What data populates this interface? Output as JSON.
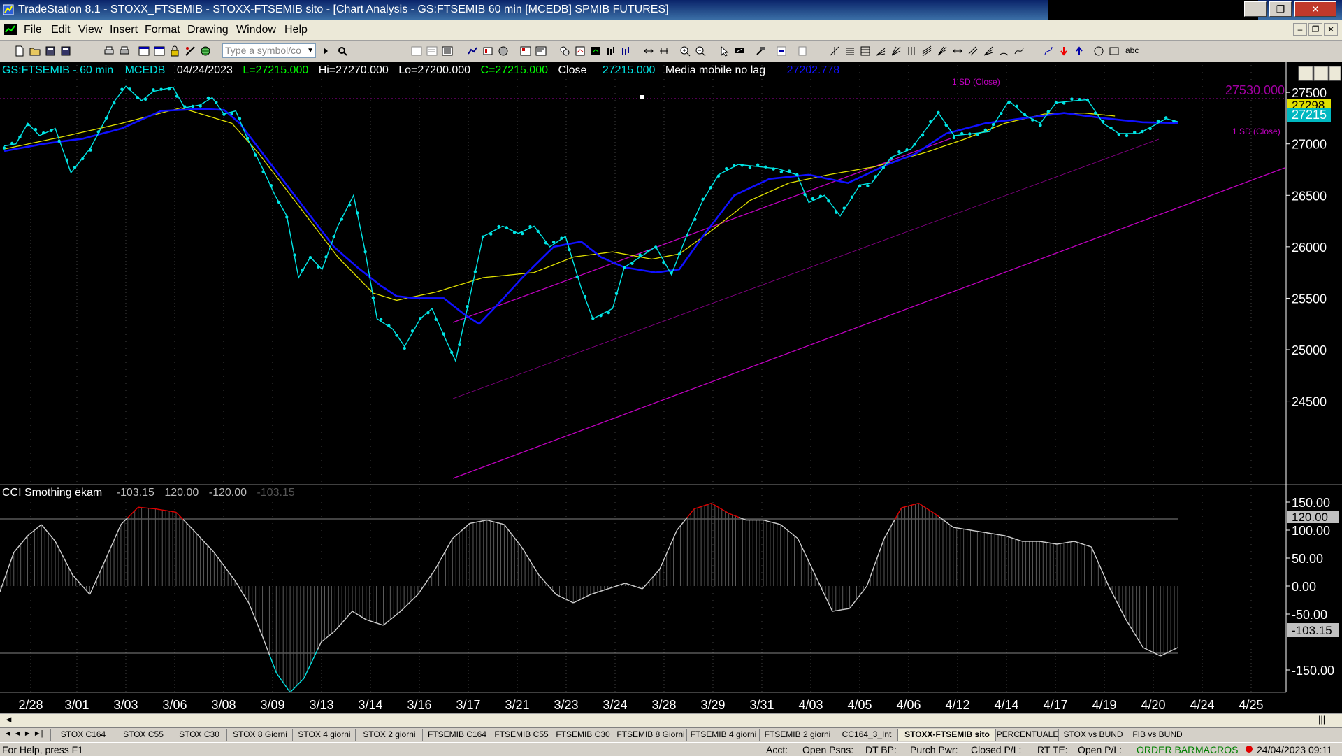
{
  "window": {
    "title": "TradeStation 8.1 - STOXX_FTSEMIB - STOXX-FTSEMIB sito - [Chart Analysis - GS:FTSEMIB  60 min  [MCEDB] SPMIB FUTURES]",
    "minimize": "–",
    "maximize": "❐",
    "close": "✕"
  },
  "menu": {
    "items": [
      "File",
      "Edit",
      "View",
      "Insert",
      "Format",
      "Drawing",
      "Window",
      "Help"
    ],
    "mdi_minimize": "–",
    "mdi_restore": "❐",
    "mdi_close": "✕"
  },
  "toolbar": {
    "symbol_placeholder": "Type a symbol/co",
    "abc_label": "abc"
  },
  "chart": {
    "header": {
      "symbol": "GS:FTSEMIB - 60 min",
      "data": "MCEDB",
      "date": "04/24/2023",
      "last": "L=27215.000",
      "high": "Hi=27270.000",
      "low": "Lo=27200.000",
      "close": "C=27215.000",
      "close_label": "Close",
      "close_value": "27215.000",
      "indicator": "Media mobile no lag",
      "indicator_value": "27202.778"
    },
    "channel_upper_label": "1 SD (Close)",
    "channel_right_label": "1 SD (Close)",
    "price_marker_magenta": "27530.000",
    "price_marker_yellow": "27298",
    "price_marker_cyan": "27215",
    "cci_header": {
      "name": "CCI Smothing ekam",
      "v1": "-103.15",
      "v2": "120.00",
      "v3": "-120.00",
      "v4": "-103.15"
    },
    "cci_marker_120": "120.00",
    "cci_marker_current": "-103.15",
    "cci_marker_behind": "-120.00",
    "colors": {
      "close_dots": "#00e5e5",
      "blue_ma": "#1010ff",
      "yellow_ma": "#e0e000",
      "channel": "#c000c0",
      "cci_line": "#d0d0d0",
      "cci_extreme": "#e00000"
    }
  },
  "chart_data": {
    "type": "line",
    "price_axis": {
      "ticks": [
        27500,
        27000,
        26500,
        26000,
        25500,
        25000,
        24500
      ],
      "tick_labels": [
        "27500",
        "27000",
        "26500",
        "26000",
        "25500",
        "25000",
        "24500"
      ],
      "range": [
        24300,
        27800
      ]
    },
    "cci_axis": {
      "ticks": [
        150,
        100,
        50,
        0,
        -50,
        -150
      ],
      "tick_labels": [
        "150.00",
        "100.00",
        "50.00",
        "0.00",
        "-50.00",
        "-150.00"
      ],
      "levels": [
        120,
        -120
      ],
      "range": [
        -190,
        165
      ]
    },
    "x_labels": [
      "2/28",
      "3/01",
      "3/03",
      "3/06",
      "3/08",
      "3/09",
      "3/13",
      "3/14",
      "3/16",
      "3/17",
      "3/21",
      "3/23",
      "3/24",
      "3/28",
      "3/29",
      "3/31",
      "4/03",
      "4/05",
      "4/06",
      "4/12",
      "4/14",
      "4/17",
      "4/19",
      "4/20",
      "4/24",
      "4/25"
    ],
    "n_bars": 270,
    "series": [
      {
        "name": "Close",
        "anchors": [
          [
            0,
            26980
          ],
          [
            3,
            27000
          ],
          [
            6,
            27200
          ],
          [
            9,
            27080
          ],
          [
            13,
            27150
          ],
          [
            17,
            26720
          ],
          [
            22,
            26960
          ],
          [
            26,
            27250
          ],
          [
            28,
            27410
          ],
          [
            31,
            27560
          ],
          [
            35,
            27420
          ],
          [
            38,
            27510
          ],
          [
            43,
            27550
          ],
          [
            46,
            27350
          ],
          [
            50,
            27380
          ],
          [
            53,
            27450
          ],
          [
            56,
            27290
          ],
          [
            59,
            27320
          ],
          [
            62,
            27050
          ],
          [
            66,
            26750
          ],
          [
            69,
            26500
          ],
          [
            72,
            26300
          ],
          [
            75,
            25700
          ],
          [
            78,
            25900
          ],
          [
            81,
            25780
          ],
          [
            85,
            26200
          ],
          [
            89,
            26500
          ],
          [
            92,
            25950
          ],
          [
            95,
            25300
          ],
          [
            99,
            25200
          ],
          [
            102,
            25030
          ],
          [
            106,
            25300
          ],
          [
            109,
            25400
          ],
          [
            112,
            25140
          ],
          [
            115,
            24890
          ],
          [
            118,
            25400
          ],
          [
            122,
            26100
          ],
          [
            127,
            26200
          ],
          [
            131,
            26130
          ],
          [
            135,
            26200
          ],
          [
            139,
            26000
          ],
          [
            143,
            26100
          ],
          [
            147,
            25600
          ],
          [
            150,
            25300
          ],
          [
            155,
            25400
          ],
          [
            158,
            25800
          ],
          [
            162,
            25900
          ],
          [
            166,
            26000
          ],
          [
            170,
            25730
          ],
          [
            174,
            26120
          ],
          [
            178,
            26450
          ],
          [
            182,
            26700
          ],
          [
            187,
            26800
          ],
          [
            192,
            26780
          ],
          [
            197,
            26760
          ],
          [
            202,
            26700
          ],
          [
            205,
            26430
          ],
          [
            209,
            26500
          ],
          [
            213,
            26300
          ],
          [
            218,
            26600
          ],
          [
            221,
            26620
          ],
          [
            226,
            26870
          ],
          [
            231,
            26950
          ],
          [
            235,
            27150
          ],
          [
            238,
            27300
          ],
          [
            242,
            27080
          ],
          [
            247,
            27100
          ],
          [
            251,
            27120
          ],
          [
            256,
            27420
          ],
          [
            260,
            27280
          ],
          [
            264,
            27200
          ],
          [
            268,
            27400
          ],
          [
            273,
            27420
          ],
          [
            276,
            27430
          ],
          [
            280,
            27200
          ],
          [
            284,
            27100
          ],
          [
            289,
            27100
          ],
          [
            293,
            27180
          ],
          [
            296,
            27245
          ],
          [
            299,
            27215
          ]
        ]
      },
      {
        "name": "Media mobile no lag",
        "anchors": [
          [
            0,
            26930
          ],
          [
            10,
            27000
          ],
          [
            20,
            27050
          ],
          [
            30,
            27150
          ],
          [
            40,
            27320
          ],
          [
            50,
            27340
          ],
          [
            56,
            27330
          ],
          [
            60,
            27200
          ],
          [
            66,
            26900
          ],
          [
            72,
            26600
          ],
          [
            78,
            26300
          ],
          [
            84,
            26000
          ],
          [
            90,
            25800
          ],
          [
            96,
            25620
          ],
          [
            100,
            25520
          ],
          [
            105,
            25500
          ],
          [
            112,
            25500
          ],
          [
            117,
            25350
          ],
          [
            121,
            25250
          ],
          [
            126,
            25450
          ],
          [
            132,
            25700
          ],
          [
            140,
            26000
          ],
          [
            147,
            26050
          ],
          [
            152,
            25900
          ],
          [
            158,
            25800
          ],
          [
            166,
            25750
          ],
          [
            172,
            25780
          ],
          [
            178,
            26100
          ],
          [
            186,
            26500
          ],
          [
            195,
            26660
          ],
          [
            205,
            26700
          ],
          [
            215,
            26620
          ],
          [
            225,
            26800
          ],
          [
            232,
            26900
          ],
          [
            240,
            27100
          ],
          [
            250,
            27200
          ],
          [
            260,
            27250
          ],
          [
            270,
            27300
          ],
          [
            280,
            27250
          ],
          [
            290,
            27210
          ],
          [
            299,
            27202
          ]
        ]
      },
      {
        "name": "Yellow MA",
        "anchors": [
          [
            0,
            26950
          ],
          [
            15,
            27070
          ],
          [
            30,
            27200
          ],
          [
            45,
            27350
          ],
          [
            58,
            27200
          ],
          [
            65,
            26900
          ],
          [
            75,
            26400
          ],
          [
            85,
            25900
          ],
          [
            94,
            25550
          ],
          [
            100,
            25480
          ],
          [
            110,
            25560
          ],
          [
            122,
            25700
          ],
          [
            135,
            25750
          ],
          [
            145,
            25900
          ],
          [
            155,
            25950
          ],
          [
            165,
            25880
          ],
          [
            172,
            25930
          ],
          [
            180,
            26150
          ],
          [
            190,
            26450
          ],
          [
            200,
            26620
          ],
          [
            210,
            26700
          ],
          [
            222,
            26780
          ],
          [
            235,
            26920
          ],
          [
            245,
            27050
          ],
          [
            255,
            27200
          ],
          [
            265,
            27290
          ],
          [
            275,
            27300
          ],
          [
            283,
            27270
          ]
        ]
      },
      {
        "name": "CCI Smothing ekam",
        "anchors": [
          [
            0,
            -10
          ],
          [
            4,
            60
          ],
          [
            8,
            90
          ],
          [
            12,
            110
          ],
          [
            16,
            80
          ],
          [
            21,
            20
          ],
          [
            26,
            -15
          ],
          [
            30,
            40
          ],
          [
            35,
            110
          ],
          [
            40,
            141
          ],
          [
            45,
            138
          ],
          [
            51,
            132
          ],
          [
            56,
            100
          ],
          [
            62,
            60
          ],
          [
            68,
            10
          ],
          [
            72,
            -30
          ],
          [
            76,
            -90
          ],
          [
            80,
            -155
          ],
          [
            84,
            -190
          ],
          [
            88,
            -165
          ],
          [
            93,
            -100
          ],
          [
            97,
            -80
          ],
          [
            102,
            -45
          ],
          [
            106,
            -60
          ],
          [
            111,
            -70
          ],
          [
            116,
            -45
          ],
          [
            121,
            -15
          ],
          [
            126,
            30
          ],
          [
            131,
            85
          ],
          [
            136,
            112
          ],
          [
            141,
            118
          ],
          [
            146,
            110
          ],
          [
            151,
            70
          ],
          [
            156,
            20
          ],
          [
            161,
            -15
          ],
          [
            166,
            -30
          ],
          [
            171,
            -15
          ],
          [
            176,
            -5
          ],
          [
            181,
            5
          ],
          [
            186,
            -5
          ],
          [
            191,
            30
          ],
          [
            196,
            100
          ],
          [
            201,
            138
          ],
          [
            206,
            148
          ],
          [
            211,
            130
          ],
          [
            216,
            118
          ],
          [
            221,
            118
          ],
          [
            226,
            110
          ],
          [
            231,
            85
          ],
          [
            236,
            20
          ],
          [
            241,
            -45
          ],
          [
            246,
            -40
          ],
          [
            251,
            0
          ],
          [
            256,
            85
          ],
          [
            261,
            140
          ],
          [
            266,
            148
          ],
          [
            271,
            128
          ],
          [
            276,
            105
          ],
          [
            281,
            100
          ],
          [
            286,
            95
          ],
          [
            291,
            90
          ],
          [
            296,
            80
          ],
          [
            301,
            80
          ],
          [
            306,
            75
          ],
          [
            311,
            80
          ],
          [
            316,
            70
          ],
          [
            321,
            0
          ],
          [
            326,
            -60
          ],
          [
            331,
            -110
          ],
          [
            336,
            -125
          ],
          [
            341,
            -110
          ]
        ]
      }
    ],
    "grid": true,
    "legend": "none"
  },
  "tabs": [
    "STOX C164",
    "STOX C55",
    "STOX  C30",
    "STOX  8 Giorni",
    "STOX 4 giorni",
    "STOX  2 giorni",
    "FTSEMIB C164",
    "FTSEMIB C55",
    "FTSEMIB C30",
    "FTSEMIB  8 Giorni",
    "FTSEMIB  4 giorni",
    "FTSEMIB  2 giorni",
    "CC164_3_Int",
    "STOXX-FTSEMIB sito",
    "PERCENTUALE",
    "STOX vs BUND",
    "FIB vs BUND"
  ],
  "active_tab": "STOXX-FTSEMIB sito",
  "status": {
    "help": "For Help, press F1",
    "acct": "Acct:",
    "open_psns": "Open Psns:",
    "dt_bp": "DT BP:",
    "purch_pwr": "Purch Pwr:",
    "closed_pl": "Closed P/L:",
    "rt_te": "RT TE:",
    "open_pl": "Open P/L:",
    "order_bar": "ORDER BAR",
    "macros": "MACROS",
    "datetime": "24/04/2023 09:11"
  }
}
